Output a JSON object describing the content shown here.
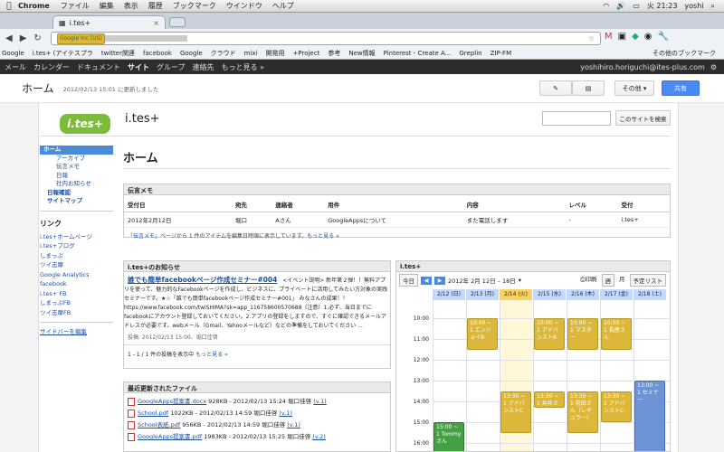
{
  "mac": {
    "menus": [
      "Chrome",
      "ファイル",
      "編集",
      "表示",
      "履歴",
      "ブックマーク",
      "ウインドウ",
      "ヘルプ"
    ],
    "clock": "火 21:23",
    "user": "yoshi"
  },
  "browser": {
    "tab_title": "i.tes+",
    "url_ev": "Google Inc [US]",
    "bookmarks": [
      "Google",
      "i.tes+ (アイテスプラ",
      "twitter関連",
      "facebook",
      "Google",
      "クラウド",
      "mixi",
      "開発用",
      "+Project",
      "参考",
      "New情報",
      "Pinterest - Create A...",
      "Greplin",
      "ZIP-FM"
    ],
    "other_bookmarks": "その他のブックマーク"
  },
  "gbar": {
    "items": [
      "メール",
      "カレンダー",
      "ドキュメント",
      "サイト",
      "グループ",
      "連絡先",
      "もっと見る »"
    ],
    "current": "サイト",
    "user_email": "yoshihiro.horiguchi@ites-plus.com"
  },
  "header": {
    "title": "ホーム",
    "updated": "2012/02/13 15:01 に更新しました",
    "other_label": "その他 ▾",
    "share_label": "共有"
  },
  "site": {
    "logo": "i.tes+",
    "title": "i.tes+",
    "search_button": "このサイトを検索"
  },
  "nav": {
    "items": [
      {
        "label": "ホーム",
        "cls": "sel"
      },
      {
        "label": "アーカイブ",
        "cls": "sub"
      },
      {
        "label": "伝言メモ",
        "cls": "sub"
      },
      {
        "label": "日報",
        "cls": "sub"
      },
      {
        "label": "社内お知らせ",
        "cls": "sub"
      },
      {
        "label": "日報確認",
        "cls": "sub2"
      },
      {
        "label": "サイトマップ",
        "cls": "sub2"
      }
    ],
    "links_heading": "リンク",
    "links": [
      "i.tes+ホームページ",
      "i.tes+ブログ",
      "しまっぷ",
      "ツイ志摩",
      "Google Analytics",
      "facebook",
      "i.tes+ FB",
      "しまっぷFB",
      "ツイ志摩FB"
    ],
    "edit_sidebar": "サイドバーを編集"
  },
  "page_title": "ホーム",
  "memo": {
    "title": "伝言メモ",
    "headers": [
      "受付日",
      "宛先",
      "連絡者",
      "用件",
      "内容",
      "レベル",
      "受付"
    ],
    "rows": [
      [
        "2012年2月12日",
        "堀口",
        "Aさん",
        "GoogleAppsについて",
        "また電話します",
        "-",
        "i.tes+"
      ]
    ],
    "footer_pre": "「",
    "footer_link": "伝言メモ",
    "footer_mid": "」ページから 1 件のアイテムを編集日時順に表示しています。",
    "footer_more": "もっと見る »"
  },
  "news": {
    "title": "i.tes+のお知らせ",
    "post_title": "誰でも簡単facebookページ作成セミナー#004",
    "post_body": " <イベント説明> 新年第２弾！！無料アプリを使って、魅力的なFacebookページを作成し、ビジネスに、プライベートに活用してみたい方対象の実践セミナーです。★☆「誰でも簡単facebookページ作成セミナー#001」 みなさんの成果！！https://www.facebook.com/twiSHIMA?sk=app_116758600570688（注意）1.必ず、当日までにfacebookにアカウント登録しておいてください。2.アプリの登録をしますので、すぐに確認できるメールアドレスが必要です。webメール（Gmail、Yahooメールなど）などの準備をしておいてください ...",
    "post_meta": "投稿: 2012/02/13 15:00、堀口佳啓",
    "footer": "1 - 1 / 1 件の投稿を表示中",
    "more": "もっと見る »"
  },
  "files": {
    "title": "最近更新されたファイル",
    "items": [
      {
        "name": "GoogleApps提案書.docx",
        "meta": " 928KB - 2012/02/13 15:24 堀口佳啓 ",
        "ver": "(v.1)"
      },
      {
        "name": "School.pdf",
        "meta": " 1022KB - 2012/02/13 14:59 堀口佳啓 ",
        "ver": "(v.1)"
      },
      {
        "name": "School表紙.pdf",
        "meta": " 956KB - 2012/02/13 14:59 堀口佳啓 ",
        "ver": "(v.1)"
      },
      {
        "name": "GoogleApps提案書.pdf",
        "meta": " 1983KB - 2012/02/13 15:25 堀口佳啓 ",
        "ver": "(v.2)"
      }
    ]
  },
  "calendar": {
    "title": "i.tes+",
    "today_btn": "今日",
    "range": "2012年 2月 12日 – 18日",
    "print": "印刷",
    "views": [
      "週",
      "月",
      "予定リスト"
    ],
    "days": [
      "2/12 (日)",
      "2/13 (月)",
      "2/14 (火)",
      "2/15 (水)",
      "2/16 (木)",
      "2/17 (金)",
      "2/18 (土)"
    ],
    "today_index": 2,
    "times": [
      "10:00",
      "11:00",
      "12:00",
      "13:00",
      "14:00",
      "15:00",
      "16:00"
    ],
    "events": [
      {
        "day": 1,
        "start": 10,
        "end": 11.5,
        "text": "10:00 ~ 1 エンジョイB",
        "type": ""
      },
      {
        "day": 3,
        "start": 10,
        "end": 11.5,
        "text": "10:00 ~ 1 アドバンストB",
        "type": ""
      },
      {
        "day": 4,
        "start": 10,
        "end": 11.5,
        "text": "10:00 ~ 1 マスター",
        "type": ""
      },
      {
        "day": 5,
        "start": 10,
        "end": 11.5,
        "text": "10:00 ~ 1 長屋さん",
        "type": ""
      },
      {
        "day": 2,
        "start": 13.5,
        "end": 15.5,
        "text": "13:30 ~ 1 アドバンストC",
        "type": ""
      },
      {
        "day": 3,
        "start": 13.5,
        "end": 14.3,
        "text": "13:30 ~ 1 井井さん",
        "type": ""
      },
      {
        "day": 4,
        "start": 13.5,
        "end": 15.5,
        "text": "13:30 ~ 1 前田さん（レギュラー）",
        "type": ""
      },
      {
        "day": 5,
        "start": 13.5,
        "end": 15.0,
        "text": "13:30 ~ 1 アドバンストC",
        "type": ""
      },
      {
        "day": 6,
        "start": 13.0,
        "end": 16.5,
        "text": "13:00 ~ 1 セミナー",
        "type": "b"
      },
      {
        "day": 0,
        "start": 15.0,
        "end": 16.5,
        "text": "15:00 ~ 1 Tommyさん",
        "type": "g"
      }
    ]
  }
}
